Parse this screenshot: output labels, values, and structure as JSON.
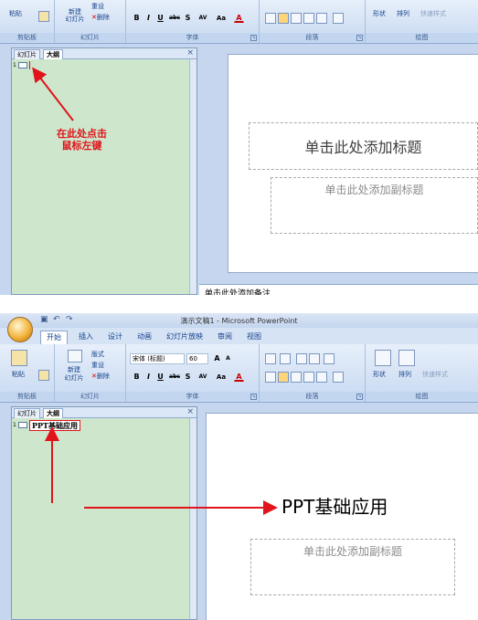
{
  "top": {
    "ribbon": {
      "paste_label": "粘贴",
      "new_slide_label": "新建\n幻灯片",
      "reset_label": "重设",
      "delete_label": "删除",
      "group_clipboard": "剪贴板",
      "group_slides": "幻灯片",
      "group_font": "字体",
      "group_paragraph": "段落",
      "group_drawing": "绘图",
      "shape_label": "形状",
      "arrange_label": "排列",
      "quick_styles_label": "快速样式"
    },
    "pane": {
      "tab_slides": "幻灯片",
      "tab_outline": "大纲",
      "close": "×",
      "slide_number": "1"
    },
    "annotation": "在此处点击\n鼠标左键",
    "slide": {
      "title_placeholder": "单击此处添加标题",
      "subtitle_placeholder": "单击此处添加副标题"
    },
    "notes_placeholder": "单击此处添加备注"
  },
  "bottom": {
    "window_title": "演示文稿1 - Microsoft PowerPoint",
    "tabs": [
      "开始",
      "插入",
      "设计",
      "动画",
      "幻灯片放映",
      "审阅",
      "视图"
    ],
    "ribbon": {
      "paste_label": "粘贴",
      "new_slide_label": "新建\n幻灯片",
      "layout_label": "版式",
      "reset_label": "重设",
      "delete_label": "删除",
      "font_name": "宋体 (标题)",
      "font_size": "60",
      "group_clipboard": "剪贴板",
      "group_slides": "幻灯片",
      "group_font": "字体",
      "group_paragraph": "段落",
      "group_drawing": "绘图",
      "shape_label": "形状",
      "arrange_label": "排列",
      "quick_styles_label": "快速样式"
    },
    "pane": {
      "tab_slides": "幻灯片",
      "tab_outline": "大纲",
      "close": "×",
      "slide_number": "1",
      "outline_text": "PPT基础应用"
    },
    "slide": {
      "title_text": "PPT基础应用",
      "subtitle_placeholder": "单击此处添加副标题"
    }
  },
  "format_buttons": [
    "B",
    "I",
    "U",
    "abc",
    "S",
    "AV",
    "Aa",
    "A"
  ],
  "font_size_buttons": [
    "A",
    "A"
  ],
  "colors": {
    "annotation_red": "#e0141a",
    "pane_green": "#cde6cc",
    "ribbon_blue": "#c7d9f1"
  }
}
